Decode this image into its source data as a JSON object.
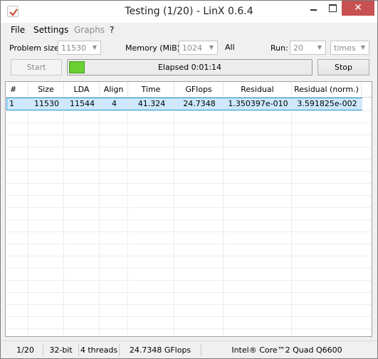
{
  "window": {
    "title": "Testing (1/20) - LinX 0.6.4"
  },
  "titlebar": {
    "close_glyph": "✕"
  },
  "menu": {
    "file": "File",
    "settings": "Settings",
    "graphs": "Graphs",
    "help": "?"
  },
  "controls": {
    "problem_size_label": "Problem size:",
    "problem_size_value": "11530",
    "memory_label": "Memory (MiB):",
    "memory_value": "1024",
    "all_label": "All",
    "run_label": "Run:",
    "run_value": "20",
    "run_unit": "times"
  },
  "actions": {
    "start_label": "Start",
    "stop_label": "Stop",
    "elapsed_text": "Elapsed 0:01:14",
    "progress_fraction": 0.06
  },
  "table": {
    "columns": [
      "#",
      "Size",
      "LDA",
      "Align",
      "Time",
      "GFlops",
      "Residual",
      "Residual (norm.)"
    ],
    "rows": [
      [
        "1",
        "11530",
        "11544",
        "4",
        "41.324",
        "24.7348",
        "1.350397e-010",
        "3.591825e-002"
      ]
    ]
  },
  "status": {
    "progress": "1/20",
    "bitness": "32-bit",
    "threads": "4 threads",
    "peak": "24.7348 GFlops peak",
    "cpu": "Intel® Core™2 Quad Q6600"
  },
  "colors": {
    "progress_fill": "#6ccf34",
    "selection": "#cde8ff",
    "close_button": "#c75050"
  }
}
